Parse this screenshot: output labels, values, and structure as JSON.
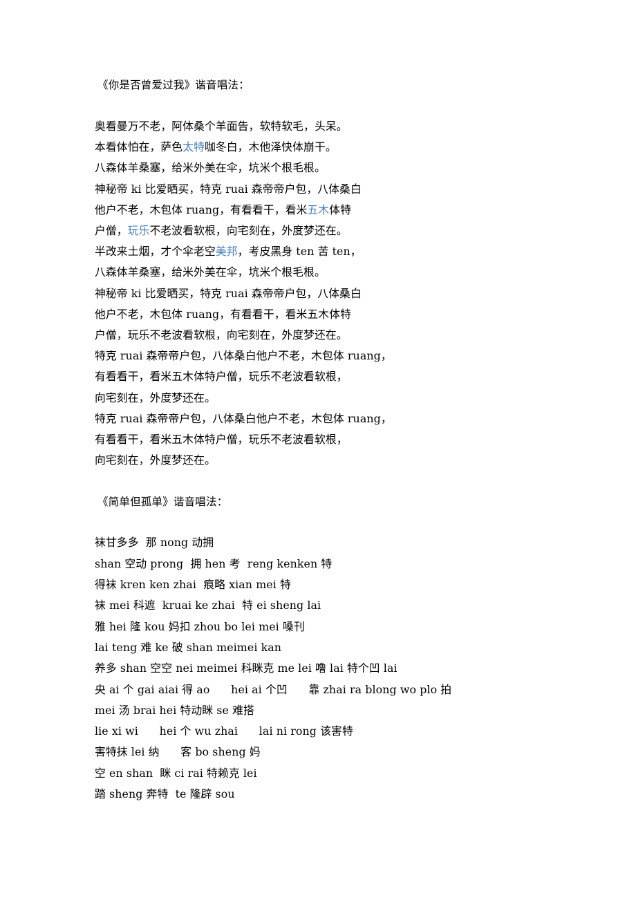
{
  "document": {
    "colors": {
      "text": "#000000",
      "highlight": "#4a7db5",
      "background": "#ffffff"
    },
    "sections": [
      {
        "id": "song-1",
        "title": "《你是否曾爱过我》谐音唱法：",
        "lines": [
          [
            {
              "t": "奥看曼万不老，阿体桑个羊面告，软特软毛，头呆。"
            }
          ],
          [
            {
              "t": "本看体怕在，萨色"
            },
            {
              "t": "太特",
              "hl": true
            },
            {
              "t": "咖冬白，木他泽快体崩干。"
            }
          ],
          [
            {
              "t": "八森体羊桑塞，给米外美在伞，坑米个根毛根。"
            }
          ],
          [
            {
              "t": "神秘帝 ki 比爱晒买，特克 ruai 森帝帝户包，八体桑白"
            }
          ],
          [
            {
              "t": "他户不老，木包体 ruang，有看看干，看米"
            },
            {
              "t": "五木",
              "hl": true
            },
            {
              "t": "体特"
            }
          ],
          [
            {
              "t": "户僧，"
            },
            {
              "t": "玩乐",
              "hl": true
            },
            {
              "t": "不老波看软根，向宅刻在，外度梦还在。"
            }
          ],
          [
            {
              "t": "半改来土烟，才个伞老空"
            },
            {
              "t": "美邦",
              "hl": true
            },
            {
              "t": "，考皮黑身 ten 苦 ten，"
            }
          ],
          [
            {
              "t": "八森体羊桑塞，给米外美在伞，坑米个根毛根。"
            }
          ],
          [
            {
              "t": "神秘帝 ki 比爱晒买，特克 ruai 森帝帝户包，八体桑白"
            }
          ],
          [
            {
              "t": "他户不老，木包体 ruang，有看看干，看米五木体特"
            }
          ],
          [
            {
              "t": "户僧，玩乐不老波看软根，向宅刻在，外度梦还在。"
            }
          ],
          [
            {
              "t": "特克 ruai 森帝帝户包，八体桑白他户不老，木包体 ruang，"
            }
          ],
          [
            {
              "t": "有看看干，看米五木体特户僧，玩乐不老波看软根，"
            }
          ],
          [
            {
              "t": "向宅刻在，外度梦还在。"
            }
          ],
          [
            {
              "t": "特克 ruai 森帝帝户包，八体桑白他户不老，木包体 ruang，"
            }
          ],
          [
            {
              "t": "有看看干，看米五木体特户僧，玩乐不老波看软根，"
            }
          ],
          [
            {
              "t": "向宅刻在，外度梦还在。"
            }
          ]
        ]
      },
      {
        "id": "song-2",
        "title": "《简单但孤单》谐音唱法：",
        "lines": [
          [
            {
              "t": "袜甘多多  那 nong 动拥"
            }
          ],
          [
            {
              "t": "shan 空动 prong  拥 hen 考  reng kenken 特"
            }
          ],
          [
            {
              "t": "得袜 kren ken zhai  痕略 xian mei 特"
            }
          ],
          [
            {
              "t": "袜 mei 科遮  kruai ke zhai  特 ei sheng lai"
            }
          ],
          [
            {
              "t": "雅 hei 隆 kou 妈扣 zhou bo lei mei 嗓刊"
            }
          ],
          [
            {
              "t": "lai teng 难 ke 破 shan meimei kan"
            }
          ],
          [
            {
              "t": "养多 shan 空空 nei meimei 科眯克 me lei 噜 lai 特个凹 lai"
            }
          ],
          [
            {
              "t": "央 ai 个 gai aiai 得 ao      hei ai 个凹      靠 zhai ra blong wo plo 拍"
            }
          ],
          [
            {
              "t": "mei 汤 brai hei 特动眯 se 难搭"
            }
          ],
          [
            {
              "t": "lie xi wi      hei 个 wu zhai      lai ni rong 该害特"
            }
          ],
          [
            {
              "t": "害特抹 lei 纳      客 bo sheng 妈"
            }
          ],
          [
            {
              "t": "空 en shan  眯 ci rai 特赖克 lei"
            }
          ],
          [
            {
              "t": "踏 sheng 奔特  te 隆辟 sou"
            }
          ]
        ]
      }
    ]
  }
}
